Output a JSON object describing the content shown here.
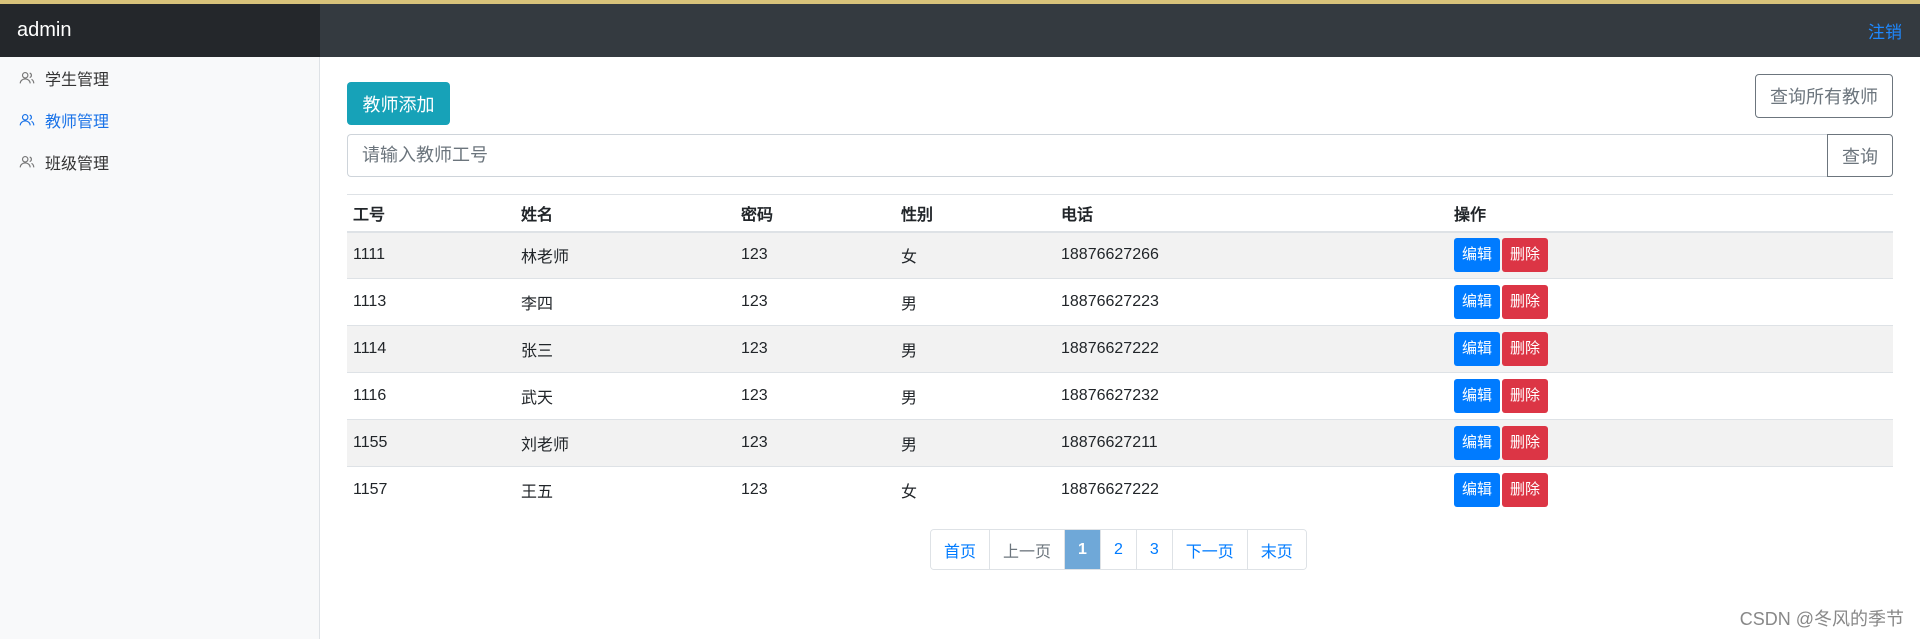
{
  "navbar": {
    "brand": "admin",
    "logout_label": "注销"
  },
  "sidebar": {
    "items": [
      {
        "label": "学生管理",
        "icon": "users-icon",
        "active": false
      },
      {
        "label": "教师管理",
        "icon": "users-icon",
        "active": true
      },
      {
        "label": "班级管理",
        "icon": "users-icon",
        "active": false
      }
    ]
  },
  "toolbar": {
    "add_label": "教师添加",
    "query_all_label": "查询所有教师",
    "search_placeholder": "请输入教师工号",
    "search_label": "查询"
  },
  "table": {
    "headers": [
      "工号",
      "姓名",
      "密码",
      "性别",
      "电话",
      "操作"
    ],
    "rows": [
      {
        "id": "1111",
        "name": "林老师",
        "password": "123",
        "gender": "女",
        "phone": "18876627266"
      },
      {
        "id": "1113",
        "name": "李四",
        "password": "123",
        "gender": "男",
        "phone": "18876627223"
      },
      {
        "id": "1114",
        "name": "张三",
        "password": "123",
        "gender": "男",
        "phone": "18876627222"
      },
      {
        "id": "1116",
        "name": "武天",
        "password": "123",
        "gender": "男",
        "phone": "18876627232"
      },
      {
        "id": "1155",
        "name": "刘老师",
        "password": "123",
        "gender": "男",
        "phone": "18876627211"
      },
      {
        "id": "1157",
        "name": "王五",
        "password": "123",
        "gender": "女",
        "phone": "18876627222"
      }
    ],
    "edit_label": "编辑",
    "delete_label": "删除"
  },
  "pagination": {
    "first": "首页",
    "prev": "上一页",
    "pages": [
      "1",
      "2",
      "3"
    ],
    "current": "1",
    "next": "下一页",
    "last": "末页"
  },
  "watermark": "CSDN @冬风的季节",
  "colors": {
    "navbar": "#343a40",
    "brand_bg": "#24272b",
    "accent": "#007bff",
    "info": "#17a2b8",
    "danger": "#dc3545"
  }
}
